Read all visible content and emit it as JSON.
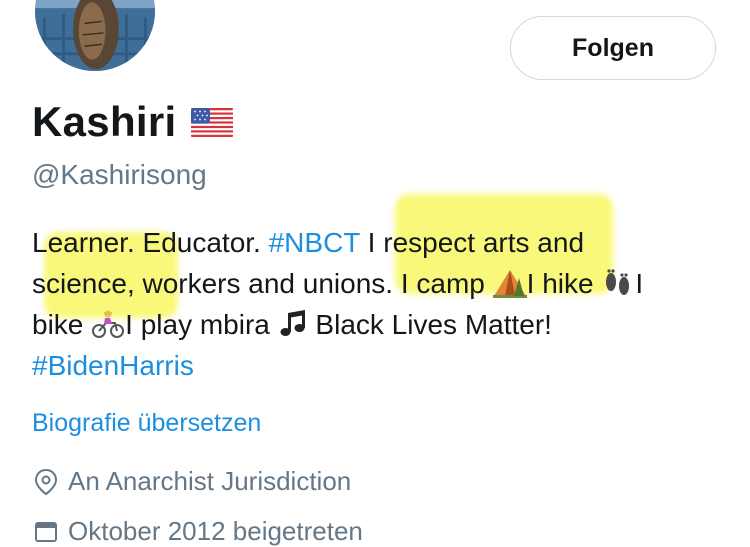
{
  "profile": {
    "display_name": "Kashiri",
    "flag_icon": "us-flag-icon",
    "handle": "@Kashirisong",
    "follow_label": "Folgen"
  },
  "bio": {
    "line1": {
      "t1": "Learner. Educator. ",
      "tag": "#NBCT",
      "t2": " I respect arts and"
    },
    "line2": {
      "t1": "science, workers and unions. I camp",
      "t2": "I hike",
      "t3": "I"
    },
    "line3": {
      "t1": "bike ",
      "t2": "I play mbira ",
      "t3": " Black Lives Matter!"
    },
    "line4": {
      "tag": "#BidenHarris"
    }
  },
  "translate_label": "Biografie übersetzen",
  "location": {
    "icon": "location-pin-icon",
    "text": "An Anarchist Jurisdiction"
  },
  "joined": {
    "icon": "calendar-icon",
    "text": "Oktober 2012 beigetreten"
  },
  "colors": {
    "link": "#1d8ee0",
    "secondary_text": "#657786",
    "highlight": "#f8f546"
  }
}
